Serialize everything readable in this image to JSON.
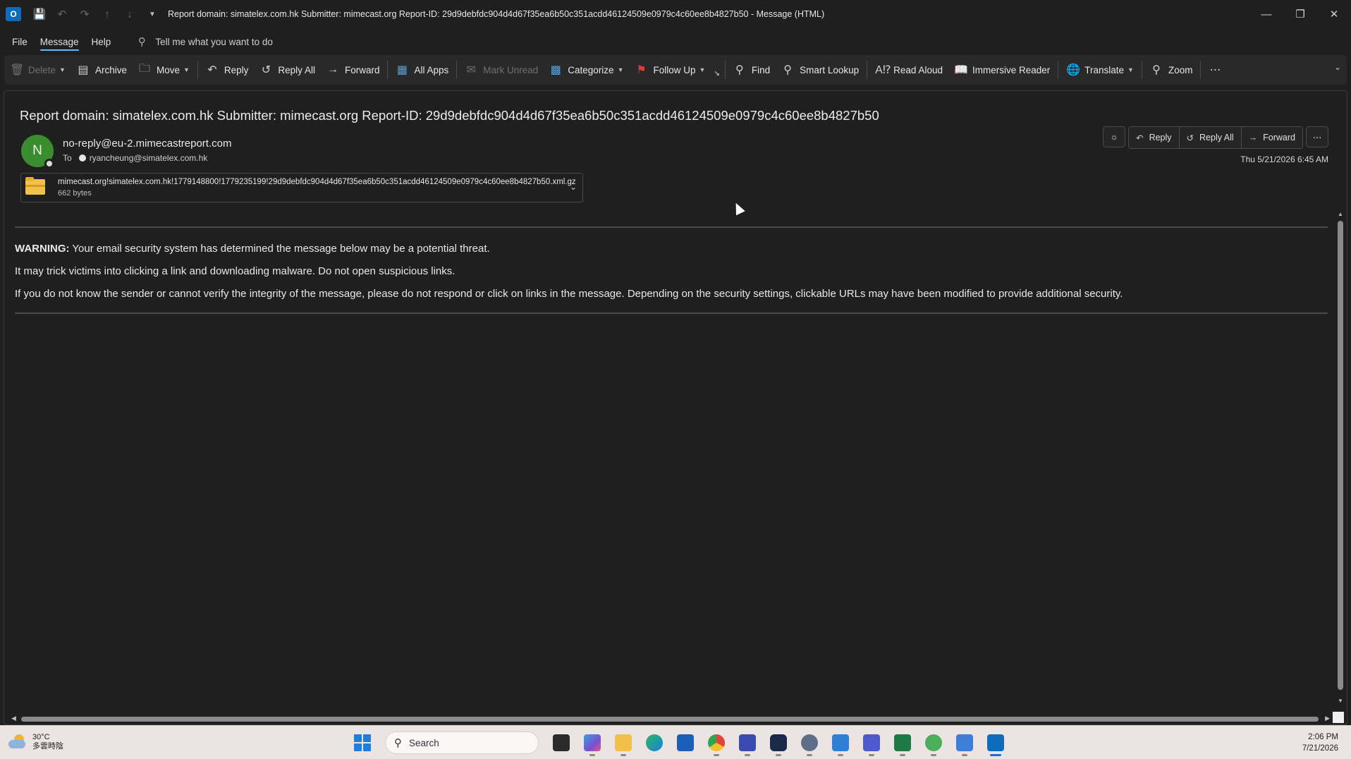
{
  "window": {
    "title": "Report domain: simatelex.com.hk Submitter: mimecast.org Report-ID: 29d9debfdc904d4d67f35ea6b50c351acdd46124509e0979c4c60ee8b4827b50  -  Message (HTML)",
    "app_icon_letter": "O"
  },
  "menu": {
    "tabs": [
      "File",
      "Message",
      "Help"
    ],
    "active_tab": "Message",
    "tell_me": "Tell me what you want to do"
  },
  "ribbon": {
    "delete": "Delete",
    "archive": "Archive",
    "move": "Move",
    "reply": "Reply",
    "reply_all": "Reply All",
    "forward": "Forward",
    "all_apps": "All Apps",
    "mark_unread": "Mark Unread",
    "categorize": "Categorize",
    "follow_up": "Follow Up",
    "find": "Find",
    "smart_lookup": "Smart Lookup",
    "read_aloud": "Read Aloud",
    "immersive_reader": "Immersive Reader",
    "translate": "Translate",
    "zoom": "Zoom"
  },
  "message": {
    "subject": "Report domain: simatelex.com.hk Submitter: mimecast.org Report-ID: 29d9debfdc904d4d67f35ea6b50c351acdd46124509e0979c4c60ee8b4827b50",
    "avatar_initial": "N",
    "sender": "no-reply@eu-2.mimecastreport.com",
    "to_label": "To",
    "recipient": "ryancheung@simatelex.com.hk",
    "datetime": "Thu 5/21/2026 6:45 AM",
    "actions": {
      "reply": "Reply",
      "reply_all": "Reply All",
      "forward": "Forward"
    },
    "attachment": {
      "name": "mimecast.org!simatelex.com.hk!1779148800!1779235199!29d9debfdc904d4d67f35ea6b50c351acdd46124509e0979c4c60ee8b4827b50.xml.gz",
      "size": "662 bytes"
    },
    "body": {
      "warning_label": "WARNING:",
      "warning_text": " Your email security system has determined the message below may be a potential threat.",
      "line2": "It may trick victims into clicking a link and downloading malware. Do not open suspicious links.",
      "line3": "If you do not know the sender or cannot verify the integrity of the message, please do not respond or click on links in the message. Depending on the security settings, clickable URLs may have been modified to provide additional security."
    }
  },
  "taskbar": {
    "temperature": "30°C",
    "weather_desc": "多雲時陰",
    "search_placeholder": "Search",
    "time": "2:06 PM",
    "date": "7/21/2026"
  },
  "colors": {
    "accent": "#6cb8f6",
    "avatar": "#3a8d2e",
    "follow_up_flag": "#e03a3a",
    "taskbar_bg": "#ece4e3"
  }
}
